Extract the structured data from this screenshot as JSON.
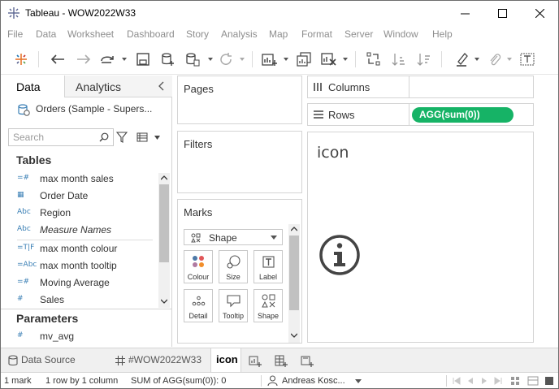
{
  "window": {
    "title": "Tableau - WOW2022W33"
  },
  "menu": {
    "items": [
      "File",
      "Data",
      "Worksheet",
      "Dashboard",
      "Story",
      "Analysis",
      "Map",
      "Format",
      "Server",
      "Window",
      "Help"
    ]
  },
  "left_pane": {
    "tab_data": "Data",
    "tab_analytics": "Analytics",
    "datasource": "Orders (Sample - Supers...",
    "search_placeholder": "Search",
    "tables_heading": "Tables",
    "fields": [
      {
        "icon": "=#",
        "label": "max month sales",
        "italic": false
      },
      {
        "icon": "▦",
        "label": "Order Date",
        "italic": false
      },
      {
        "icon": "Abc",
        "label": "Region",
        "italic": false
      },
      {
        "icon": "Abc",
        "label": "Measure Names",
        "italic": true
      },
      {
        "icon": "=T|F",
        "label": "max month colour",
        "italic": false
      },
      {
        "icon": "=Abc",
        "label": "max month tooltip",
        "italic": false
      },
      {
        "icon": "=#",
        "label": "Moving Average",
        "italic": false
      },
      {
        "icon": "#",
        "label": "Sales",
        "italic": false
      }
    ],
    "parameters_heading": "Parameters",
    "parameters": [
      {
        "icon": "#",
        "label": "mv_avg"
      }
    ]
  },
  "cards": {
    "pages": "Pages",
    "filters": "Filters",
    "marks": "Marks",
    "mark_type": "Shape",
    "mark_buttons": [
      {
        "label": "Colour",
        "icon": "colour-icon"
      },
      {
        "label": "Size",
        "icon": "size-icon"
      },
      {
        "label": "Label",
        "icon": "label-icon"
      },
      {
        "label": "Detail",
        "icon": "detail-icon"
      },
      {
        "label": "Tooltip",
        "icon": "tooltip-icon"
      },
      {
        "label": "Shape",
        "icon": "shape-icon"
      }
    ]
  },
  "shelves": {
    "columns_label": "Columns",
    "rows_label": "Rows",
    "rows_pill": "AGG(sum(0))",
    "pill_color": "#16b366"
  },
  "view": {
    "title": "icon",
    "glyph": "info-icon"
  },
  "bottom_tabs": {
    "data_source": "Data Source",
    "sheet1": "#WOW2022W33",
    "sheet2": "icon"
  },
  "status": {
    "marks": "1 mark",
    "rows_cols": "1 row by 1 column",
    "sum": "SUM of AGG(sum(0)): 0",
    "user": "Andreas Kosc..."
  }
}
